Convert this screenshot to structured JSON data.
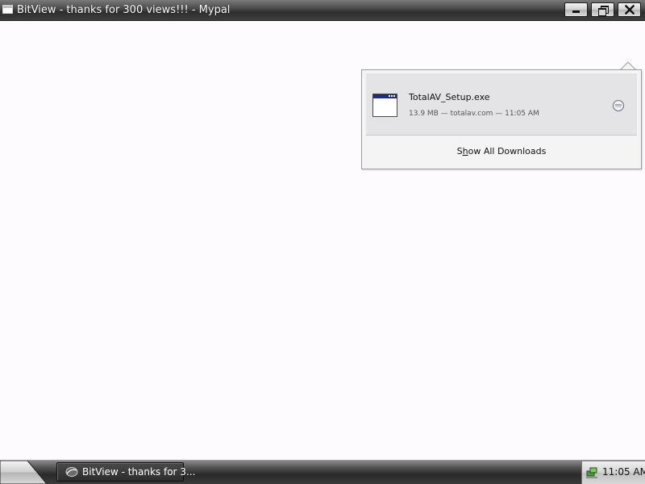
{
  "window": {
    "title": "BitView - thanks for 300 views!!! - Mypal",
    "app_icon": "window-icon",
    "controls": {
      "minimize_icon": "minimize-icon",
      "restore_icon": "restore-icon",
      "close_icon": "close-icon"
    }
  },
  "downloads_panel": {
    "items": [
      {
        "file_name": "TotalAV_Setup.exe",
        "status": "13.9 MB — totalav.com — 11:05 AM",
        "file_icon": "exe-file-icon",
        "action_icon": "open-folder-icon"
      }
    ],
    "show_all_prefix": "S",
    "show_all_underlined": "h",
    "show_all_rest": "ow All Downloads"
  },
  "taskbar": {
    "start_icon": "start-icon",
    "task": {
      "label": "BitView - thanks for 3...",
      "icon": "mypal-icon"
    },
    "tray": {
      "icon": "network-icon",
      "clock": "11:05 AM"
    }
  },
  "colors": {
    "titlebar": "#3d3d3d",
    "content_bg": "#fdfbfe",
    "panel_bg": "#f5f4f5",
    "item_bg": "#e4e4e6",
    "file_icon_bar": "#1d2b8f"
  }
}
